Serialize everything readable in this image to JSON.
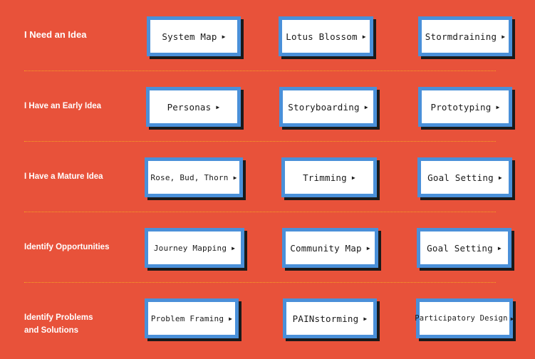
{
  "rows": [
    {
      "label": "I Need an Idea",
      "buttons": [
        "System Map",
        "Lotus Blossom",
        "Stormdraining"
      ]
    },
    {
      "label": "I Have an Early Idea",
      "buttons": [
        "Personas",
        "Storyboarding",
        "Prototyping"
      ]
    },
    {
      "label": "I Have a Mature Idea",
      "buttons": [
        "Rose, Bud, Thorn",
        "Trimming",
        "Goal Setting"
      ]
    },
    {
      "label": "Identify Opportunities",
      "buttons": [
        "Journey Mapping",
        "Community Map",
        "Goal Setting"
      ]
    },
    {
      "label_line1": "Identify Problems",
      "label_line2": "and Solutions",
      "buttons": [
        "Problem Framing",
        "PAINstorming",
        "Participatory Design"
      ]
    }
  ],
  "arrow_glyph": "▶",
  "colors": {
    "background": "#E8523A",
    "button_border": "#4A90D9",
    "separator": "#F5A623"
  }
}
